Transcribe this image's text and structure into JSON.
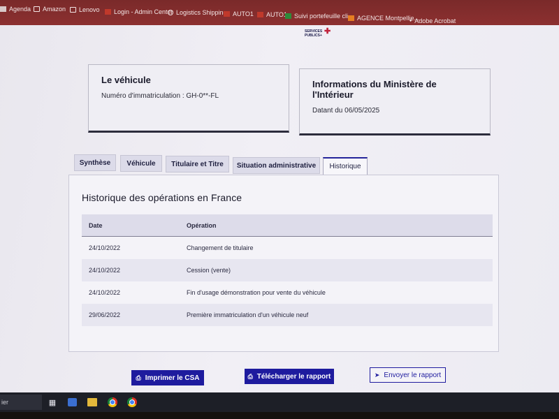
{
  "bookmarks": [
    {
      "label": "Agenda",
      "icon": "square-icon"
    },
    {
      "label": "Amazon",
      "icon": "folder-icon"
    },
    {
      "label": "Lenovo",
      "icon": "folder-icon"
    },
    {
      "label": "Login - Admin Center",
      "icon": "red-square-icon"
    },
    {
      "label": "Logistics Shipping",
      "icon": "globe-icon"
    },
    {
      "label": "AUTO1",
      "icon": "red-square-icon"
    },
    {
      "label": "AUTO1",
      "icon": "red-square-icon"
    },
    {
      "label": "Suivi portefeuille cli...",
      "icon": "green-icon"
    },
    {
      "label": "AGENCE Montpellie...",
      "icon": "orange-icon"
    },
    {
      "label": "Adobe Acrobat",
      "icon": "pdf-icon"
    }
  ],
  "logo": {
    "line1": "SERVICES",
    "line2": "PUBLICS+"
  },
  "vehicle_card": {
    "title": "Le véhicule",
    "registration": "Numéro d'immatriculation : GH-0**-FL"
  },
  "ministry_card": {
    "title": "Informations du Ministère de l'Intérieur",
    "date": "Datant du 06/05/2025"
  },
  "tabs": [
    {
      "label": "Synthèse",
      "active": false
    },
    {
      "label": "Véhicule",
      "active": false
    },
    {
      "label": "Titulaire et Titre",
      "active": false
    },
    {
      "label": "Situation administrative",
      "active": false
    },
    {
      "label": "Historique",
      "active": true
    }
  ],
  "history": {
    "title": "Historique des opérations en France",
    "columns": {
      "date": "Date",
      "operation": "Opération"
    },
    "rows": [
      {
        "date": "24/10/2022",
        "operation": "Changement de titulaire"
      },
      {
        "date": "24/10/2022",
        "operation": "Cession (vente)"
      },
      {
        "date": "24/10/2022",
        "operation": "Fin d'usage démonstration pour vente du véhicule"
      },
      {
        "date": "29/06/2022",
        "operation": "Première immatriculation d'un véhicule neuf"
      }
    ]
  },
  "buttons": {
    "print": "Imprimer le CSA",
    "download": "Télécharger le rapport",
    "send": "Envoyer le rapport"
  },
  "taskbar": {
    "search_text": "ier"
  },
  "colors": {
    "primary": "#1e1b9e",
    "bookmarks_bar": "#8c3030"
  }
}
